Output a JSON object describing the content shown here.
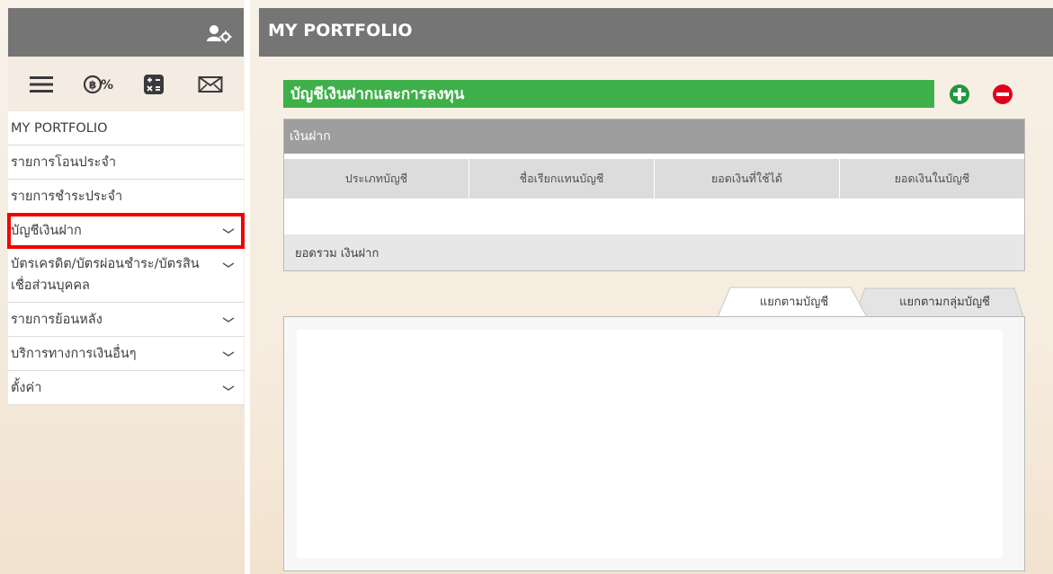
{
  "sidebar": {
    "items": [
      {
        "label": "MY PORTFOLIO",
        "has_chevron": false
      },
      {
        "label": "รายการโอนประจำ",
        "has_chevron": false
      },
      {
        "label": "รายการชำระประจำ",
        "has_chevron": false
      },
      {
        "label": "บัญชีเงินฝาก",
        "has_chevron": true,
        "highlighted": true
      },
      {
        "label": "บัตรเครดิต/บัตรผ่อนชำระ/บัตรสินเชื่อส่วนบุคคล",
        "has_chevron": true
      },
      {
        "label": "รายการย้อนหลัง",
        "has_chevron": true
      },
      {
        "label": "บริการทางการเงินอื่นๆ",
        "has_chevron": true
      },
      {
        "label": "ตั้งค่า",
        "has_chevron": true
      }
    ],
    "icons": [
      "hamburger-menu-icon",
      "baht-percent-icon",
      "calculator-icon",
      "envelope-icon"
    ],
    "top_icon": "user-settings-icon"
  },
  "header": {
    "title": "MY PORTFOLIO"
  },
  "section": {
    "title": "บัญชีเงินฝากและการลงทุน",
    "add_icon": "plus-circle-icon",
    "remove_icon": "minus-circle-icon"
  },
  "deposit_panel": {
    "title": "เงินฝาก",
    "columns": [
      "ประเภทบัญชี",
      "ชื่อเรียกแทนบัญชี",
      "ยอดเงินที่ใช้ได้",
      "ยอดเงินในบัญชี"
    ],
    "total_label": "ยอดรวม เงินฝาก"
  },
  "tabs": [
    {
      "label": "แยกตามบัญชี",
      "active": true
    },
    {
      "label": "แยกตามกลุ่มบัญชี",
      "active": false
    }
  ],
  "colors": {
    "header_bg": "#757575",
    "section_green": "#3eb049",
    "add_green": "#1f9a3a",
    "remove_red": "#e0001b",
    "highlight_red": "#f20000"
  }
}
